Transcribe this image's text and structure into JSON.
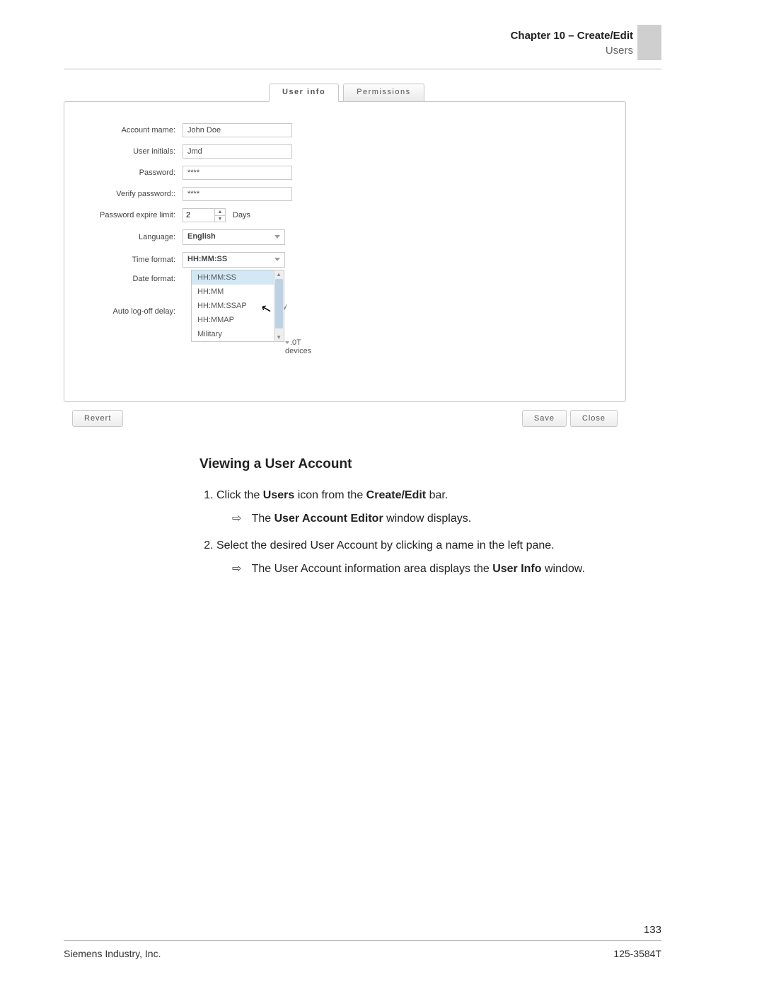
{
  "header": {
    "chapter": "Chapter 10 – Create/Edit",
    "section": "Users"
  },
  "tabs": {
    "user_info": "User info",
    "permissions": "Permissions"
  },
  "form": {
    "labels": {
      "account_name": "Account mame:",
      "user_initials": "User initials:",
      "password": "Password:",
      "verify_password": "Verify password::",
      "password_expire": "Password expire limit:",
      "language": "Language:",
      "time_format": "Time format:",
      "date_format": "Date format:",
      "auto_logoff": "Auto log-off delay:"
    },
    "values": {
      "account_name": "John Doe",
      "user_initials": "Jmd",
      "password": "****",
      "verify_password": "****",
      "password_expire": "2",
      "expire_unit": "Days",
      "language": "English",
      "time_format": "HH:MM:SS",
      "faint_y": "y"
    },
    "time_options": [
      "HH:MM:SS",
      "HH:MM",
      "HH:MM:SSAP",
      "HH:MMAP",
      "Military"
    ],
    "ot_devices": ".0T devices"
  },
  "buttons": {
    "revert": "Revert",
    "save": "Save",
    "close": "Close"
  },
  "body": {
    "heading": "Viewing a User Account",
    "step1_a": "Click the ",
    "step1_b": "Users",
    "step1_c": " icon from the ",
    "step1_d": "Create/Edit",
    "step1_e": " bar.",
    "res1_a": "The ",
    "res1_b": "User Account Editor",
    "res1_c": " window displays.",
    "step2": "Select the desired User Account by clicking a name in the left pane.",
    "res2_a": "The User Account information area displays the ",
    "res2_b": "User Info",
    "res2_c": " window."
  },
  "footer": {
    "page_no": "133",
    "left": "Siemens Industry, Inc.",
    "right": "125-3584T"
  }
}
